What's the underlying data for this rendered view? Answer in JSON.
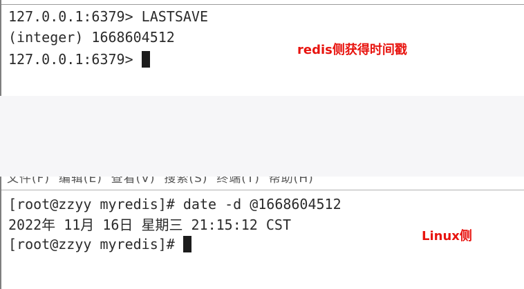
{
  "top_terminal": {
    "lines": [
      "127.0.0.1:6379> LASTSAVE",
      "(integer) 1668604512",
      "127.0.0.1:6379> "
    ],
    "annotation": "redis侧获得时间戳"
  },
  "bottom_terminal": {
    "menu_partial": "文件(F)  编辑(E)  查看(V)  搜索(S)  终端(T)  帮助(H)",
    "lines": [
      "[root@zzyy myredis]# date -d @1668604512",
      "2022年 11月 16日 星期三 21:15:12 CST",
      "[root@zzyy myredis]# "
    ],
    "annotation": "Linux侧"
  },
  "colors": {
    "annotation": "#e8140f",
    "terminal_text": "#2b2b2b",
    "gap_background": "#f6f6f8"
  }
}
